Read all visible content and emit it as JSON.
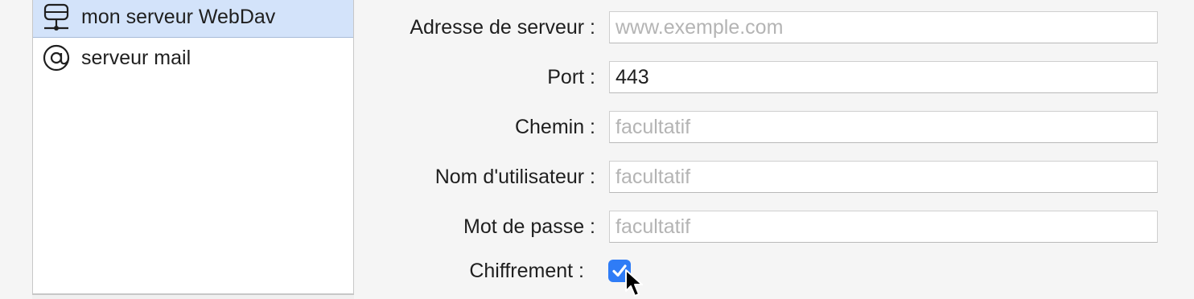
{
  "server_list": {
    "items": [
      {
        "icon": "network-server-icon",
        "label": "mon serveur WebDav",
        "selected": true
      },
      {
        "icon": "at-sign-icon",
        "label": "serveur mail",
        "selected": false
      }
    ]
  },
  "form": {
    "address": {
      "label": "Adresse de serveur :",
      "value": "",
      "placeholder": "www.exemple.com"
    },
    "port": {
      "label": "Port :",
      "value": "443",
      "placeholder": ""
    },
    "path": {
      "label": "Chemin :",
      "value": "",
      "placeholder": "facultatif"
    },
    "username": {
      "label": "Nom d'utilisateur :",
      "value": "",
      "placeholder": "facultatif"
    },
    "password": {
      "label": "Mot de passe :",
      "value": "",
      "placeholder": "facultatif"
    },
    "encryption": {
      "label": "Chiffrement :",
      "checked": true
    }
  },
  "colors": {
    "accent": "#2f7cf6",
    "selection": "#d3e3fa",
    "placeholder": "#b4b4b4"
  }
}
